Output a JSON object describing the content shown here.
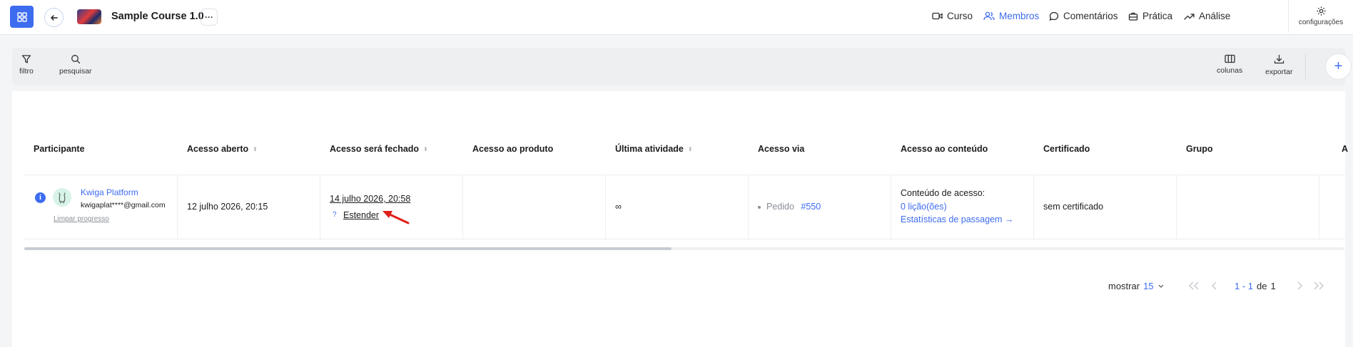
{
  "header": {
    "course_title": "Sample Course 1.0",
    "more_label": "···",
    "nav": [
      {
        "label": "Curso",
        "icon": "video-icon",
        "active": false
      },
      {
        "label": "Membros",
        "icon": "users-icon",
        "active": true
      },
      {
        "label": "Comentários",
        "icon": "comment-icon",
        "active": false
      },
      {
        "label": "Prática",
        "icon": "briefcase-icon",
        "active": false
      },
      {
        "label": "Análise",
        "icon": "trend-icon",
        "active": false
      }
    ],
    "settings_label": "configurações"
  },
  "toolbar": {
    "filter_label": "filtro",
    "search_label": "pesquisar",
    "columns_label": "colunas",
    "export_label": "exportar",
    "add_label": "+"
  },
  "table": {
    "columns": [
      {
        "label": "Participante",
        "sortable": false
      },
      {
        "label": "Acesso aberto",
        "sortable": true
      },
      {
        "label": "Acesso será fechado",
        "sortable": true
      },
      {
        "label": "Acesso ao produto",
        "sortable": false
      },
      {
        "label": "Última atividade",
        "sortable": true
      },
      {
        "label": "Acesso via",
        "sortable": false
      },
      {
        "label": "Acesso ao conteúdo",
        "sortable": false
      },
      {
        "label": "Certificado",
        "sortable": false
      },
      {
        "label": "Grupo",
        "sortable": false
      },
      {
        "label": "A",
        "sortable": false
      }
    ],
    "sort_glyph": "⬍",
    "row": {
      "info_icon": "i",
      "name": "Kwiga Platform",
      "email": "kwigaplat****@gmail.com",
      "reset_progress": "Limpar progresso",
      "access_opened": "12 julho 2026, 20:15",
      "access_closes": "14 julho 2026, 20:58",
      "help_mark": "?",
      "extend_label": "Estender",
      "product_access": "",
      "last_activity": "∞",
      "access_via_label": "Pedido",
      "access_via_order": "#550",
      "content_access_title": "Conteúdo de acesso:",
      "content_access_lessons": "0 lição(ões)",
      "content_access_stats": "Estatísticas de passagem →",
      "certificate": "sem certificado",
      "group": ""
    }
  },
  "pagination": {
    "show_label": "mostrar",
    "page_size": "15",
    "range": "1 - 1",
    "of_label": "de",
    "total": "1"
  },
  "colors": {
    "accent": "#3d6cf0",
    "annotation_arrow": "#e0201b"
  }
}
